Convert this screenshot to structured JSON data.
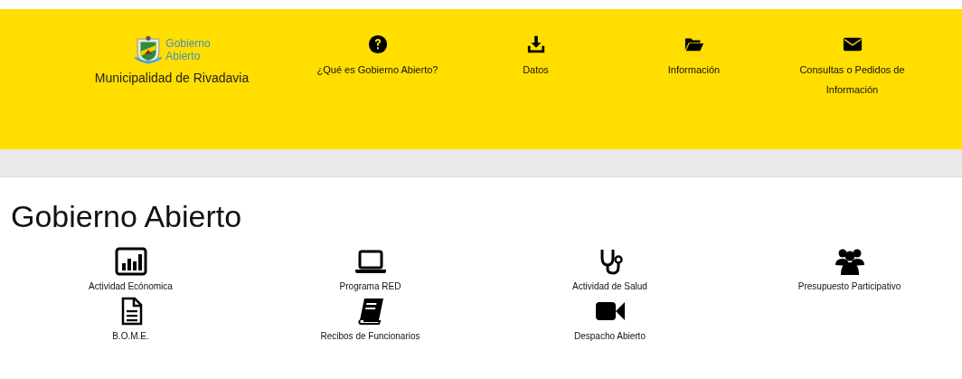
{
  "header": {
    "logo_text": [
      "Gobierno",
      "Abierto"
    ],
    "municipality": "Municipalidad de Rivadavia",
    "nav": [
      {
        "label": "¿Qué es Gobierno Abierto?"
      },
      {
        "label": "Datos"
      },
      {
        "label": "Información"
      },
      {
        "label": "Consultas o Pedidos de Información"
      }
    ]
  },
  "page_title": "Gobierno Abierto",
  "sections": [
    {
      "label": "Actividad Ecónomica"
    },
    {
      "label": "Programa RED"
    },
    {
      "label": "Actividad de Salud"
    },
    {
      "label": "Presupuesto Participativo"
    },
    {
      "label": "B.O.M.E."
    },
    {
      "label": "Recibos de Funcionarios"
    },
    {
      "label": "Despacho Abierto"
    }
  ]
}
